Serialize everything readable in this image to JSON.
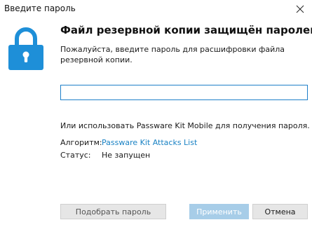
{
  "window": {
    "title": "Введите пароль"
  },
  "content": {
    "heading": "Файл резервной копии защищён паролем",
    "subtitle": "Пожалуйста, введите пароль для расшифровки файла резервной копии.",
    "password_value": "",
    "mobile_text": "Или использовать Passware Kit Mobile для получения пароля.",
    "algorithm_label": "Алгоритм:",
    "algorithm_link": "Passware Kit Attacks List",
    "status_label": "Статус:",
    "status_value": "Не запущен"
  },
  "buttons": {
    "pick_password": "Подобрать пароль",
    "apply": "Применить",
    "cancel": "Отмена"
  },
  "icons": {
    "lock": "lock-icon",
    "close": "close-icon"
  },
  "colors": {
    "accent": "#1a82c4",
    "lock": "#1e8fd8",
    "apply_disabled": "#a7cde8"
  }
}
